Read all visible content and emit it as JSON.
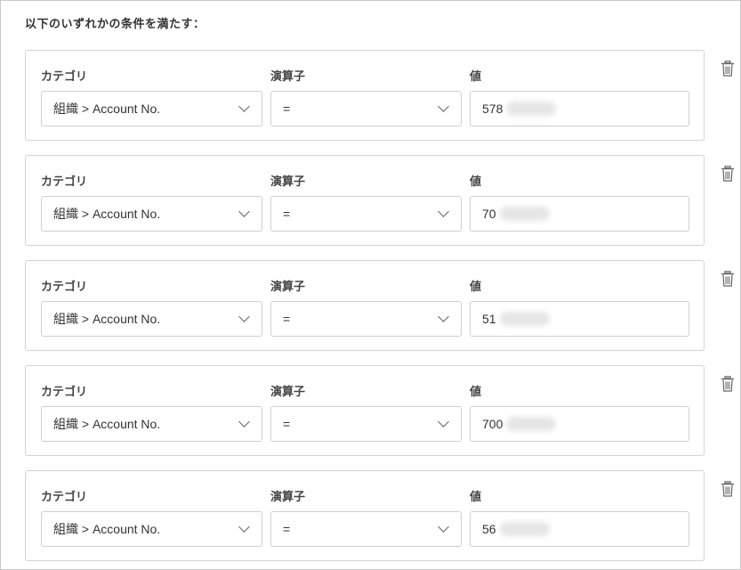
{
  "heading": "以下のいずれかの条件を満たす：",
  "labels": {
    "category": "カテゴリ",
    "operator": "演算子",
    "value": "値"
  },
  "rules": [
    {
      "category": "組織 > Account No.",
      "operator": "=",
      "value": "578"
    },
    {
      "category": "組織 > Account No.",
      "operator": "=",
      "value": "70"
    },
    {
      "category": "組織 > Account No.",
      "operator": "=",
      "value": "51"
    },
    {
      "category": "組織 > Account No.",
      "operator": "=",
      "value": "700"
    },
    {
      "category": "組織 > Account No.",
      "operator": "=",
      "value": "56"
    }
  ],
  "icons": {
    "dropdown": "chevron-down-icon",
    "delete": "trash-icon"
  }
}
